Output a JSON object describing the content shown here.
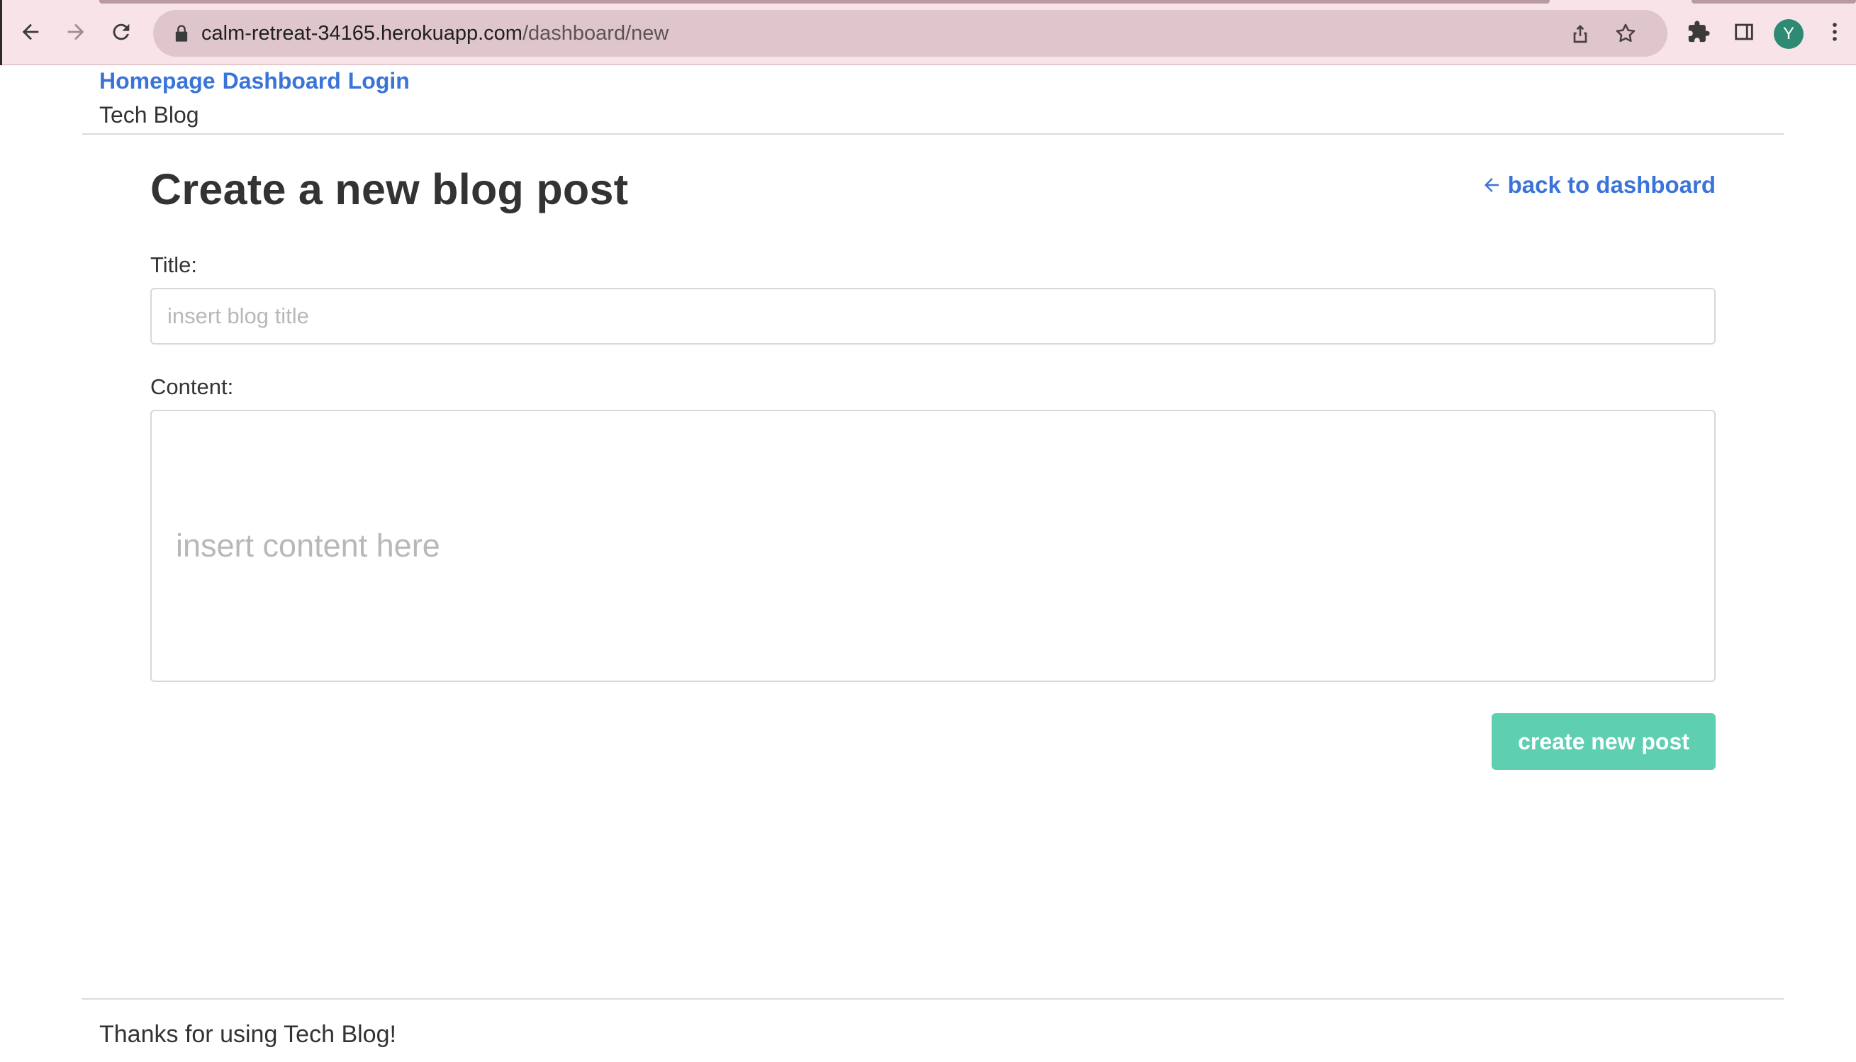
{
  "browser": {
    "url_host": "calm-retreat-34165.herokuapp.com",
    "url_path": "/dashboard/new",
    "profile_initial": "Y",
    "icons": [
      "back-arrow-icon",
      "forward-arrow-icon",
      "reload-icon",
      "lock-icon",
      "share-icon",
      "star-icon",
      "extensions-icon",
      "side-panel-icon",
      "more-vert-icon"
    ]
  },
  "header": {
    "nav": [
      "Homepage",
      "Dashboard",
      "Login"
    ],
    "site_name": "Tech Blog"
  },
  "main": {
    "heading": "Create a new blog post",
    "back_link": "back to dashboard",
    "title_label": "Title:",
    "title_placeholder": "insert blog title",
    "title_value": "",
    "content_label": "Content:",
    "content_placeholder": "insert content here",
    "submit_label": "create new post"
  },
  "footer": {
    "text": "Thanks for using Tech Blog!"
  },
  "colors": {
    "link": "#3a74d8",
    "button": "#5ecfb0",
    "chrome": "#f8e4e8",
    "omnibox": "#dfc6cc",
    "avatar": "#2f8a74"
  }
}
